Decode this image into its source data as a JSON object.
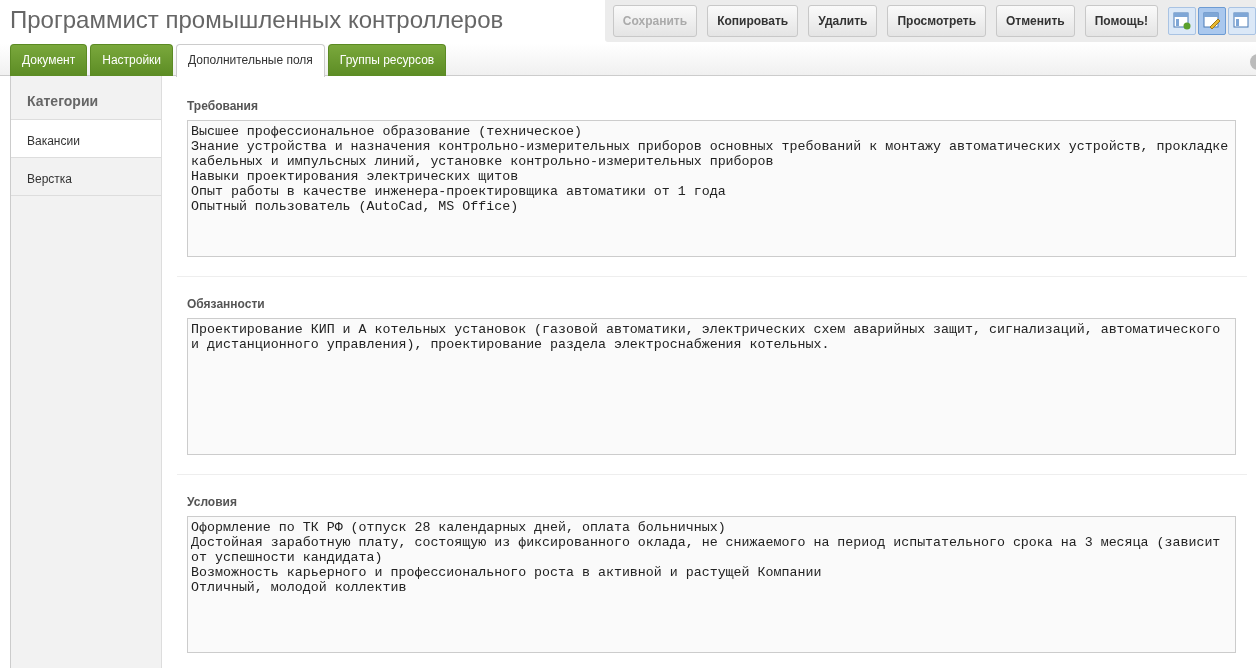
{
  "title": "Программист промышленных контроллеров",
  "buttons": [
    {
      "label": "Сохранить",
      "disabled": true
    },
    {
      "label": "Копировать",
      "disabled": false
    },
    {
      "label": "Удалить",
      "disabled": false
    },
    {
      "label": "Просмотреть",
      "disabled": false
    },
    {
      "label": "Отменить",
      "disabled": false
    },
    {
      "label": "Помощь!",
      "disabled": false
    }
  ],
  "view_buttons": [
    {
      "selected": false
    },
    {
      "selected": true
    },
    {
      "selected": false
    }
  ],
  "tabs": [
    {
      "label": "Документ",
      "selected": false
    },
    {
      "label": "Настройки",
      "selected": false
    },
    {
      "label": "Дополнительные поля",
      "selected": true
    },
    {
      "label": "Группы ресурсов",
      "selected": false
    }
  ],
  "sidebar": {
    "title": "Категории",
    "items": [
      {
        "label": "Вакансии",
        "selected": true
      },
      {
        "label": "Верстка",
        "selected": false
      }
    ]
  },
  "fields": [
    {
      "label": "Требования",
      "value": "Высшее профессиональное образование (техническое)\nЗнание устройства и назначения контрольно-измерительных приборов основных требований к монтажу автоматических устройств, прокладке кабельных и импульсных линий, установке контрольно-измерительных приборов\nНавыки проектирования электрических щитов\nОпыт работы в качестве инженера-проектировщика автоматики от 1 года\nОпытный пользователь (AutoCad, MS Office)"
    },
    {
      "label": "Обязанности",
      "value": "Проектирование КИП и А котельных установок (газовой автоматики, электрических схем аварийных защит, сигнализаций, автоматического и дистанционного управления), проектирование раздела электроснабжения котельных."
    },
    {
      "label": "Условия",
      "value": "Оформление по ТК РФ (отпуск 28 календарных дней, оплата больничных)\nДостойная заработную плату, состоящую из фиксированного оклада, не снижаемого на период испытательного срока на 3 месяца (зависит от успешности кандидата)\nВозможность карьерного и профессионального роста в активной и растущей Компании\nОтличный, молодой коллектив"
    }
  ]
}
